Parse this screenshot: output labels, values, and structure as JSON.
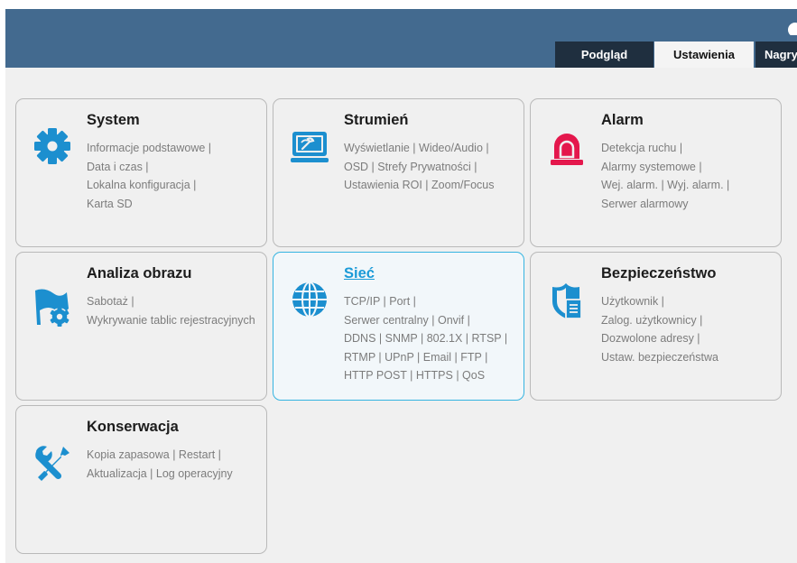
{
  "tabs": [
    {
      "label": "Podgląd",
      "active": false
    },
    {
      "label": "Ustawienia",
      "active": true
    },
    {
      "label": "Nagrywanie",
      "active": false
    }
  ],
  "colors": {
    "header": "#436a8f",
    "tab_dark": "#1f2f3f",
    "icon_blue": "#1c8fcf",
    "alarm_red": "#e4174c",
    "active_border": "#35b4e1",
    "active_title": "#1a9ad7"
  },
  "cards": {
    "system": {
      "title": "System",
      "icon": "gear-icon",
      "lines": [
        "Informacje podstawowe |",
        "Data i czas |",
        "Lokalna konfiguracja |",
        "Karta SD"
      ]
    },
    "stream": {
      "title": "Strumień",
      "icon": "monitor-icon",
      "lines": [
        "Wyświetlanie | Wideo/Audio |",
        "OSD | Strefy Prywatności |",
        "Ustawienia ROI | Zoom/Focus"
      ]
    },
    "alarm": {
      "title": "Alarm",
      "icon": "alarm-siren-icon",
      "lines": [
        "Detekcja ruchu |",
        "Alarmy systemowe |",
        "Wej. alarm. | Wyj. alarm. |",
        "Serwer alarmowy"
      ]
    },
    "analysis": {
      "title": "Analiza obrazu",
      "icon": "flag-gear-icon",
      "lines": [
        "Sabotaż |",
        "Wykrywanie tablic rejestracyjnych"
      ]
    },
    "network": {
      "title": "Sieć",
      "icon": "globe-icon",
      "active": true,
      "lines": [
        "TCP/IP | Port |",
        "Serwer centralny | Onvif |",
        "DDNS | SNMP | 802.1X | RTSP |",
        "RTMP | UPnP | Email | FTP |",
        "HTTP POST | HTTPS | QoS"
      ]
    },
    "security": {
      "title": "Bezpieczeństwo",
      "icon": "shield-document-icon",
      "lines": [
        "Użytkownik |",
        "Zalog. użytkownicy |",
        "Dozwolone adresy |",
        "Ustaw. bezpieczeństwa"
      ]
    },
    "maintenance": {
      "title": "Konserwacja",
      "icon": "wrench-screwdriver-icon",
      "lines": [
        "Kopia zapasowa  | Restart |",
        "Aktualizacja | Log operacyjny"
      ]
    }
  }
}
